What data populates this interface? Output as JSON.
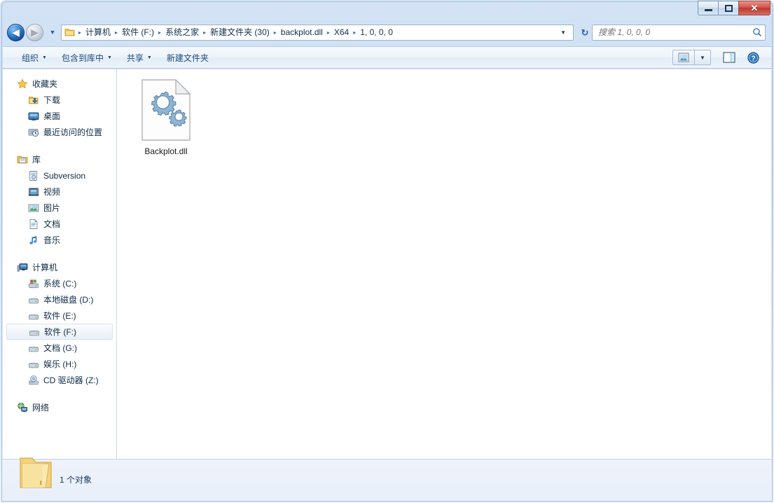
{
  "window": {
    "caption_buttons": [
      {
        "name": "minimize",
        "glyph": "minimize-icon"
      },
      {
        "name": "maximize",
        "glyph": "maximize-icon"
      },
      {
        "name": "close",
        "glyph": "✕"
      }
    ]
  },
  "nav": {
    "back_label": "◀",
    "forward_label": "▶",
    "recent_dropdown": "▼",
    "crumb_dropdown": "▼",
    "refresh_label": "↻",
    "breadcrumbs": [
      "计算机",
      "软件 (F:)",
      "系统之家",
      "新建文件夹 (30)",
      "backplot.dll",
      "X64",
      "1, 0, 0, 0"
    ],
    "separator": "▸"
  },
  "search": {
    "placeholder": "搜索 1, 0, 0, 0",
    "value": ""
  },
  "toolbar": {
    "items": [
      {
        "label": "组织",
        "has_caret": true
      },
      {
        "label": "包含到库中",
        "has_caret": true
      },
      {
        "label": "共享",
        "has_caret": true
      },
      {
        "label": "新建文件夹",
        "has_caret": false
      }
    ],
    "view_caret": "▼"
  },
  "sidebar": {
    "groups": [
      {
        "header": {
          "label": "收藏夹",
          "icon": "star-icon"
        },
        "items": [
          {
            "label": "下载",
            "icon": "downloads-icon"
          },
          {
            "label": "桌面",
            "icon": "desktop-icon"
          },
          {
            "label": "最近访问的位置",
            "icon": "recent-places-icon"
          }
        ]
      },
      {
        "header": {
          "label": "库",
          "icon": "library-icon"
        },
        "items": [
          {
            "label": "Subversion",
            "icon": "subversion-icon"
          },
          {
            "label": "视频",
            "icon": "video-icon"
          },
          {
            "label": "图片",
            "icon": "pictures-icon"
          },
          {
            "label": "文档",
            "icon": "documents-icon"
          },
          {
            "label": "音乐",
            "icon": "music-icon"
          }
        ]
      },
      {
        "header": {
          "label": "计算机",
          "icon": "computer-icon"
        },
        "items": [
          {
            "label": "系统 (C:)",
            "icon": "system-drive-icon",
            "selected": false
          },
          {
            "label": "本地磁盘 (D:)",
            "icon": "drive-icon",
            "selected": false
          },
          {
            "label": "软件 (E:)",
            "icon": "drive-icon",
            "selected": false
          },
          {
            "label": "软件 (F:)",
            "icon": "drive-icon",
            "selected": true
          },
          {
            "label": "文档 (G:)",
            "icon": "drive-icon",
            "selected": false
          },
          {
            "label": "娱乐 (H:)",
            "icon": "drive-icon",
            "selected": false
          },
          {
            "label": "CD 驱动器 (Z:)",
            "icon": "cd-drive-icon",
            "selected": false
          }
        ]
      },
      {
        "header": {
          "label": "网络",
          "icon": "network-icon"
        },
        "items": []
      }
    ]
  },
  "content": {
    "files": [
      {
        "name": "Backplot.dll",
        "icon": "dll-file-icon"
      }
    ]
  },
  "status": {
    "text": "1 个对象",
    "icon": "folder-icon"
  },
  "colors": {
    "accent": "#1c4a7a",
    "title_gradient_top": "#d3e3f5",
    "selection": "#f2f5fa",
    "close_button": "#c9453a"
  }
}
